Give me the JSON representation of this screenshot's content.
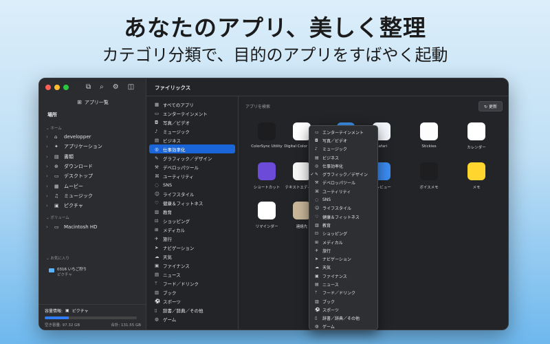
{
  "promo": {
    "headline": "あなたのアプリ、美しく整理",
    "subheadline": "カテゴリ分類で、目的のアプリをすばやく起動"
  },
  "window": {
    "title": "ファイリックス",
    "sidebar": {
      "all_apps": "アプリ一覧",
      "places": "場所",
      "home_group": "ホーム",
      "home_items": [
        {
          "label": "developper",
          "icon": "home-icon"
        },
        {
          "label": "アプリケーション",
          "icon": "apps-icon"
        },
        {
          "label": "書類",
          "icon": "document-icon"
        },
        {
          "label": "ダウンロード",
          "icon": "download-icon"
        },
        {
          "label": "デスクトップ",
          "icon": "desktop-icon"
        },
        {
          "label": "ムービー",
          "icon": "movie-icon"
        },
        {
          "label": "ミュージック",
          "icon": "music-icon"
        },
        {
          "label": "ピクチャ",
          "icon": "picture-icon"
        }
      ],
      "volume_group": "ボリューム",
      "volume_items": [
        {
          "label": "Macintosh HD",
          "icon": "disk-icon"
        }
      ],
      "favorites_group": "お気に入り",
      "favorite": {
        "name": "0316 いちご狩り",
        "sub": "ピクチャ"
      },
      "storage": {
        "label": "容量情報:",
        "location": "ピクチャ",
        "free": "空き容量: 97.32 GB",
        "total": "合計: 131.55 GB",
        "used_fraction": 0.26
      }
    },
    "categories": [
      {
        "label": "すべてのアプリ",
        "icon": "▦"
      },
      {
        "label": "エンターテインメント",
        "icon": "▭"
      },
      {
        "label": "写真／ビデオ",
        "icon": "◘"
      },
      {
        "label": "ミュージック",
        "icon": "♪"
      },
      {
        "label": "ビジネス",
        "icon": "▤"
      },
      {
        "label": "仕事効率化",
        "icon": "◎"
      },
      {
        "label": "グラフィック／デザイン",
        "icon": "✎"
      },
      {
        "label": "デベロッパツール",
        "icon": "⚒"
      },
      {
        "label": "ユーティリティ",
        "icon": "⌘"
      },
      {
        "label": "SNS",
        "icon": "◌"
      },
      {
        "label": "ライフスタイル",
        "icon": "☺"
      },
      {
        "label": "健康＆フィットネス",
        "icon": "♡"
      },
      {
        "label": "教育",
        "icon": "▥"
      },
      {
        "label": "ショッピング",
        "icon": "⊡"
      },
      {
        "label": "メディカル",
        "icon": "⊞"
      },
      {
        "label": "旅行",
        "icon": "✈"
      },
      {
        "label": "ナビゲーション",
        "icon": "➤"
      },
      {
        "label": "天気",
        "icon": "☁"
      },
      {
        "label": "ファイナンス",
        "icon": "▣"
      },
      {
        "label": "ニュース",
        "icon": "▤"
      },
      {
        "label": "フード／ドリンク",
        "icon": "ᛘ"
      },
      {
        "label": "ブック",
        "icon": "▥"
      },
      {
        "label": "スポーツ",
        "icon": "⚽"
      },
      {
        "label": "辞書／辞典／その他",
        "icon": "▯"
      },
      {
        "label": "ゲーム",
        "icon": "◍"
      }
    ],
    "selected_category": "仕事効率化",
    "main": {
      "search_placeholder": "アプリを検索",
      "refresh_label": "更新",
      "apps": [
        {
          "name": "ColorSync Utility",
          "color": "#1d1d1f"
        },
        {
          "name": "Digital Color Meter",
          "color": "#ffffff"
        },
        {
          "name": "",
          "color": "#3a8ee6"
        },
        {
          "name": "Safari",
          "color": "#f2f6fb"
        },
        {
          "name": "Stickies",
          "color": "#fdfdfd"
        },
        {
          "name": "カレンダー",
          "color": "#ffffff"
        },
        {
          "name": "ショートカット",
          "color": "#6c4bd8"
        },
        {
          "name": "テキストエディット",
          "color": "#f6f6f6"
        },
        {
          "name": "",
          "color": "#3a8ee6"
        },
        {
          "name": "プレビュー",
          "color": "#3b8bf0"
        },
        {
          "name": "ボイスメモ",
          "color": "#1e1e20"
        },
        {
          "name": "メモ",
          "color": "#ffd52e"
        },
        {
          "name": "リマインダー",
          "color": "#ffffff"
        },
        {
          "name": "連絡先",
          "color": "#c9b79a"
        }
      ]
    },
    "menu": {
      "items": [
        "エンターテインメント",
        "写真／ビデオ",
        "ミュージック",
        "ビジネス",
        "仕事効率化",
        "グラフィック／デザイン",
        "デベロッパツール",
        "ユーティリティ",
        "SNS",
        "ライフスタイル",
        "健康＆フィットネス",
        "教育",
        "ショッピング",
        "メディカル",
        "旅行",
        "ナビゲーション",
        "天気",
        "ファイナンス",
        "ニュース",
        "フード／ドリンク",
        "ブック",
        "スポーツ",
        "辞書／辞典／その他",
        "ゲーム"
      ],
      "checked": "グラフィック／デザイン"
    }
  }
}
